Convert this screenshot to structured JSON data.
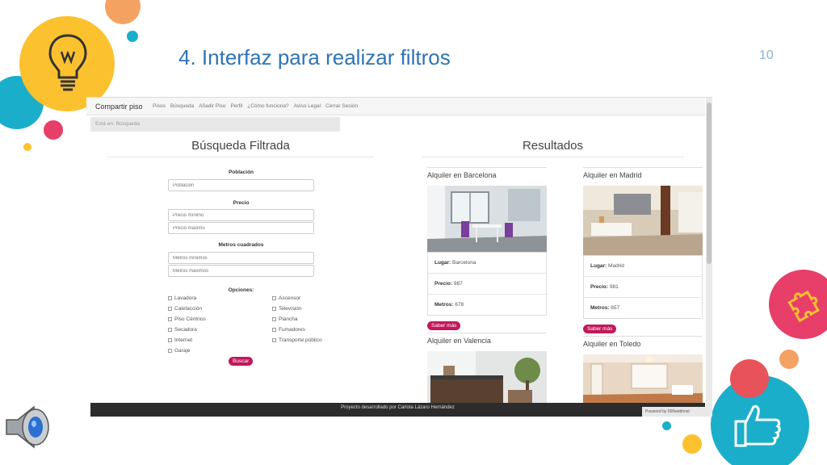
{
  "slide": {
    "title": "4. Interfaz para realizar filtros",
    "page_number": "10"
  },
  "navbar": {
    "brand": "Compartir piso",
    "links": [
      "Pisos",
      "Búsqueda",
      "Añadir Piso",
      "Perfil",
      "¿Cómo funciona?",
      "Aviso Legal",
      "Cerrar Sesión"
    ]
  },
  "breadcrumb": "Está en: Búsqueda",
  "search": {
    "title": "Búsqueda Filtrada",
    "poblacion_label": "Población",
    "poblacion_placeholder": "Población",
    "precio_label": "Precio",
    "precio_min_placeholder": "Precio mínimo",
    "precio_max_placeholder": "Precio máximo",
    "metros_label": "Metros cuadrados",
    "metros_min_placeholder": "Metros mínimos",
    "metros_max_placeholder": "Metros máximos",
    "opciones_label": "Opciones:",
    "options_left": [
      "Lavadora",
      "Calefacción",
      "Piso Céntrico",
      "Secadora",
      "Internet",
      "Garaje"
    ],
    "options_right": [
      "Ascensor",
      "Televisión",
      "Plancha",
      "Fumadores",
      "Transporte público"
    ],
    "button": "Buscar"
  },
  "results": {
    "title": "Resultados",
    "cards": [
      {
        "title": "Alquiler en Barcelona",
        "lugar_label": "Lugar:",
        "lugar": "Barcelona",
        "precio_label": "Precio:",
        "precio": "987",
        "metros_label": "Metros:",
        "metros": "678",
        "button": "Saber más"
      },
      {
        "title": "Alquiler en Madrid",
        "lugar_label": "Lugar:",
        "lugar": "Madrid",
        "precio_label": "Precio:",
        "precio": "981",
        "metros_label": "Metros:",
        "metros": "657",
        "button": "Saber más"
      },
      {
        "title": "Alquiler en Valencia"
      },
      {
        "title": "Alquiler en Toledo"
      }
    ]
  },
  "footer": {
    "text": "Proyecto desarrollado por Carlota Lázaro Hernández",
    "powered": "Powered by  000webhost"
  },
  "colors": {
    "accent": "#c2185b",
    "title_blue": "#2f74b5"
  },
  "icons": [
    "lightbulb-icon",
    "speaker-icon",
    "puzzle-icon",
    "thumbs-up-icon"
  ]
}
